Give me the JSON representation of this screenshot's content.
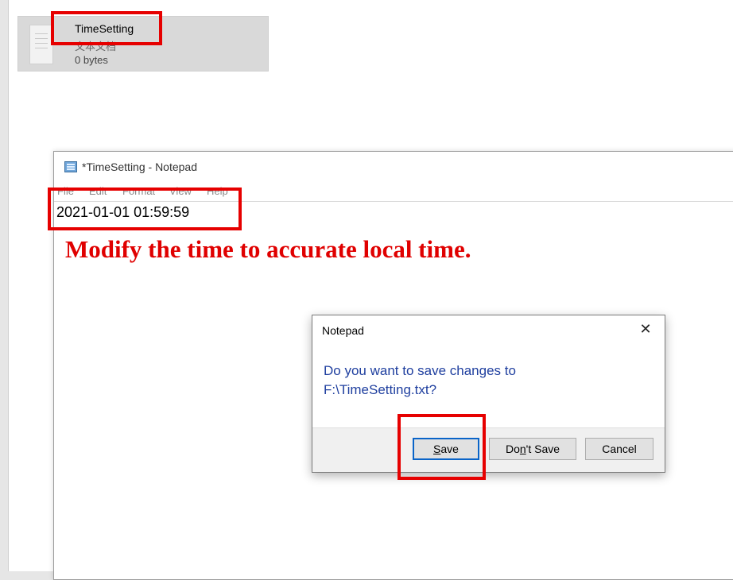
{
  "explorer": {
    "file": {
      "name": "TimeSetting",
      "type": "文本文档",
      "size": "0 bytes",
      "icon": "text-file-icon"
    }
  },
  "notepad": {
    "title": "*TimeSetting - Notepad",
    "icon": "notepad-icon",
    "menu": [
      "File",
      "Edit",
      "Format",
      "View",
      "Help"
    ],
    "content": "2021-01-01 01:59:59"
  },
  "annotation": {
    "instruction": "Modify the time to accurate local time.",
    "highlight_color": "#e60000"
  },
  "dialog": {
    "title": "Notepad",
    "close_glyph": "✕",
    "message_line1": "Do you want to save changes to",
    "message_line2": "F:\\TimeSetting.txt?",
    "message_color": "#1f3f9f",
    "buttons": {
      "save": {
        "label": "Save",
        "mnemonic": "S",
        "rest": "ave"
      },
      "dont_save": {
        "label": "Don't Save",
        "pre": "Do",
        "mnemonic": "n",
        "rest": "'t Save"
      },
      "cancel": {
        "label": "Cancel"
      }
    }
  }
}
